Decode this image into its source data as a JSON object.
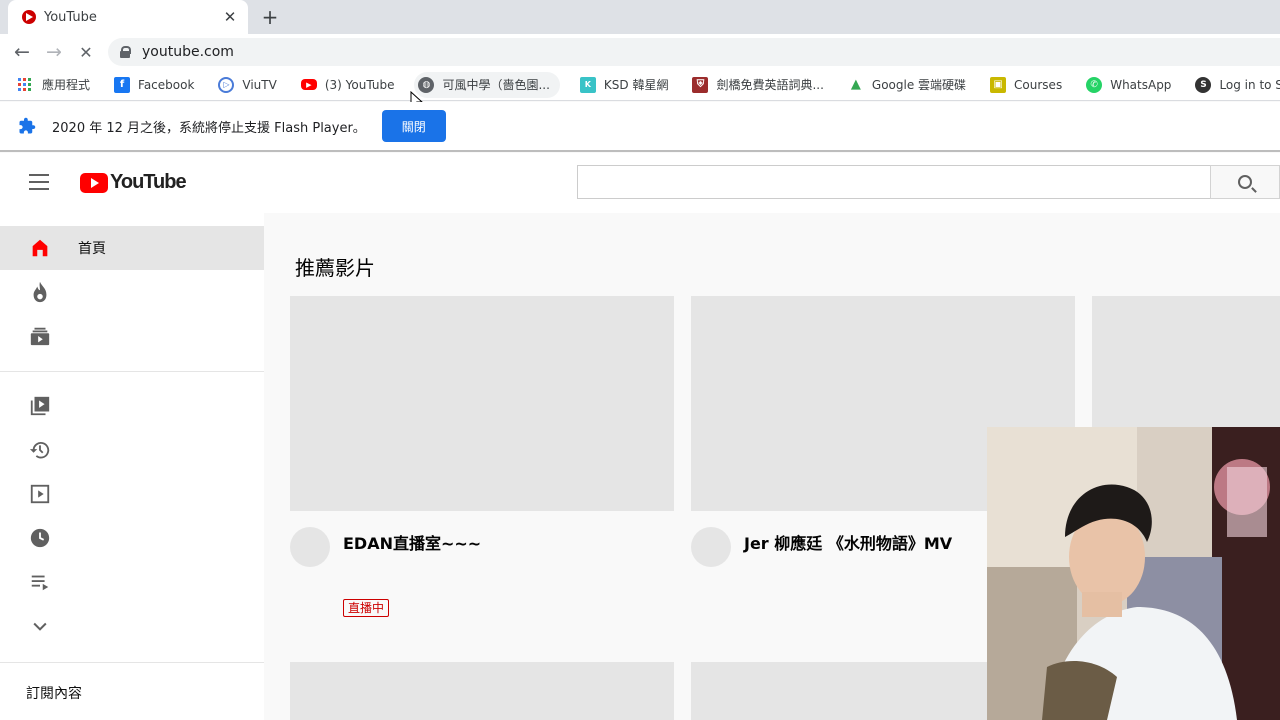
{
  "browser": {
    "tab_title": "YouTube",
    "tab_close": "✕",
    "new_tab": "+",
    "back": "←",
    "forward": "→",
    "reload": "✕",
    "url": "youtube.com"
  },
  "bookmarks": [
    {
      "label": "應用程式",
      "icon": "apps-grid-icon"
    },
    {
      "label": "Facebook",
      "icon": "facebook-icon",
      "color": "#1877f2",
      "glyph": "f"
    },
    {
      "label": "ViuTV",
      "icon": "viutv-icon",
      "color": "#4a7bd8",
      "glyph": "▷"
    },
    {
      "label": "(3) YouTube",
      "icon": "youtube-icon",
      "color": "#ff0000",
      "glyph": "▶"
    },
    {
      "label": "可風中學（嗇色園...",
      "icon": "globe-icon",
      "color": "#5f6368",
      "glyph": "🌐"
    },
    {
      "label": "KSD 韓星網",
      "icon": "ksd-icon",
      "color": "#39c3c7",
      "glyph": "K"
    },
    {
      "label": "劍橋免費英語詞典...",
      "icon": "cambridge-icon",
      "color": "#9b2c2c",
      "glyph": "⛨"
    },
    {
      "label": "Google 雲端硬碟",
      "icon": "google-drive-icon",
      "color": "#34a853",
      "glyph": "▲"
    },
    {
      "label": "Courses",
      "icon": "courses-icon",
      "color": "#c9b800",
      "glyph": "▣"
    },
    {
      "label": "WhatsApp",
      "icon": "whatsapp-icon",
      "color": "#25d366",
      "glyph": "✆"
    },
    {
      "label": "Log in to Schoology",
      "icon": "schoology-icon",
      "color": "#333333",
      "glyph": "S"
    }
  ],
  "infobar": {
    "message": "2020 年 12 月之後，系統將停止支援 Flash Player。",
    "button": "關閉"
  },
  "youtube": {
    "logo_text": "YouTube",
    "search_placeholder": "",
    "sidebar": [
      {
        "label": "首頁",
        "icon": "home-icon"
      },
      {
        "label": "",
        "icon": "trending-icon"
      },
      {
        "label": "",
        "icon": "subscriptions-icon"
      },
      {
        "label": "",
        "icon": "library-icon"
      },
      {
        "label": "",
        "icon": "history-icon"
      },
      {
        "label": "",
        "icon": "your-videos-icon"
      },
      {
        "label": "",
        "icon": "watch-later-icon"
      },
      {
        "label": "",
        "icon": "playlist-icon"
      },
      {
        "label": "",
        "icon": "chevron-down-icon"
      }
    ],
    "subscriptions_heading": "訂閱內容",
    "section_title": "推薦影片",
    "videos": [
      {
        "title": "EDAN直播室~~~",
        "badge": "直播中"
      },
      {
        "title": "Jer 柳應廷 《水刑物語》MV",
        "badge": ""
      }
    ]
  }
}
